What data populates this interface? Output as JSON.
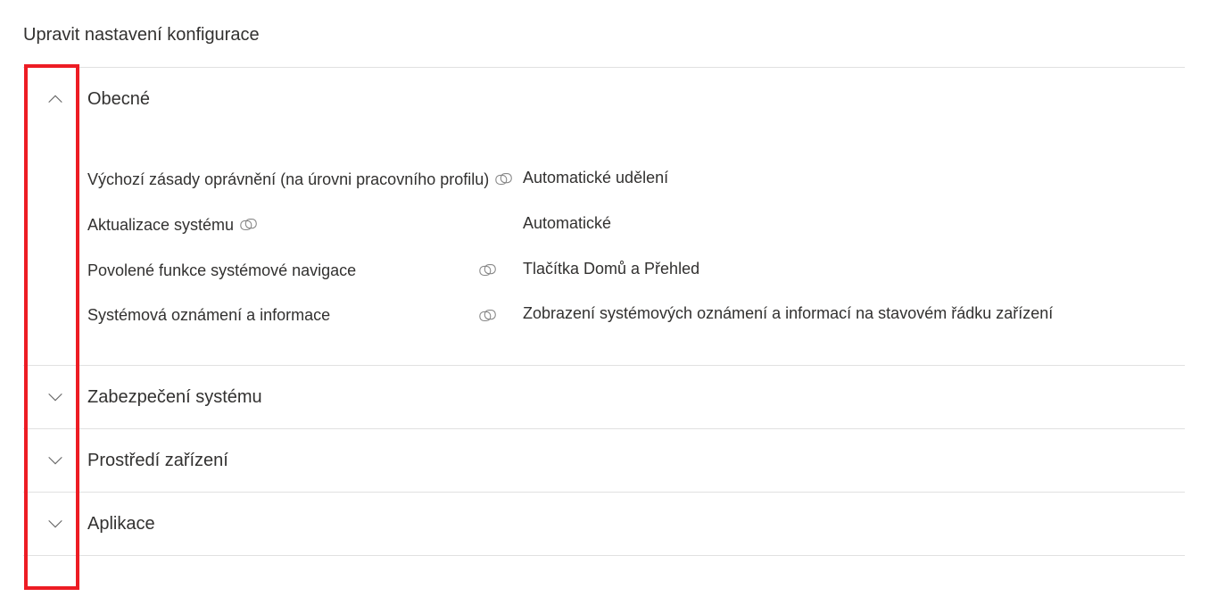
{
  "pageTitle": "Upravit nastavení konfigurace",
  "sections": [
    {
      "id": "general",
      "title": "Obecné",
      "expanded": true,
      "settings": [
        {
          "label": "Výchozí zásady oprávnění (na úrovni pracovního profilu)",
          "value": "Automatické udělení",
          "icon": true
        },
        {
          "label": "Aktualizace systému",
          "value": "Automatické",
          "icon": true
        },
        {
          "label": "Povolené funkce systémové navigace",
          "value": "Tlačítka Domů a Přehled",
          "icon": true
        },
        {
          "label": "Systémová oznámení a informace",
          "value": "Zobrazení systémových oznámení a informací na stavovém řádku zařízení",
          "icon": true
        }
      ]
    },
    {
      "id": "security",
      "title": "Zabezpečení systému",
      "expanded": false,
      "settings": []
    },
    {
      "id": "environment",
      "title": "Prostředí zařízení",
      "expanded": false,
      "settings": []
    },
    {
      "id": "applications",
      "title": "Aplikace",
      "expanded": false,
      "settings": []
    }
  ]
}
